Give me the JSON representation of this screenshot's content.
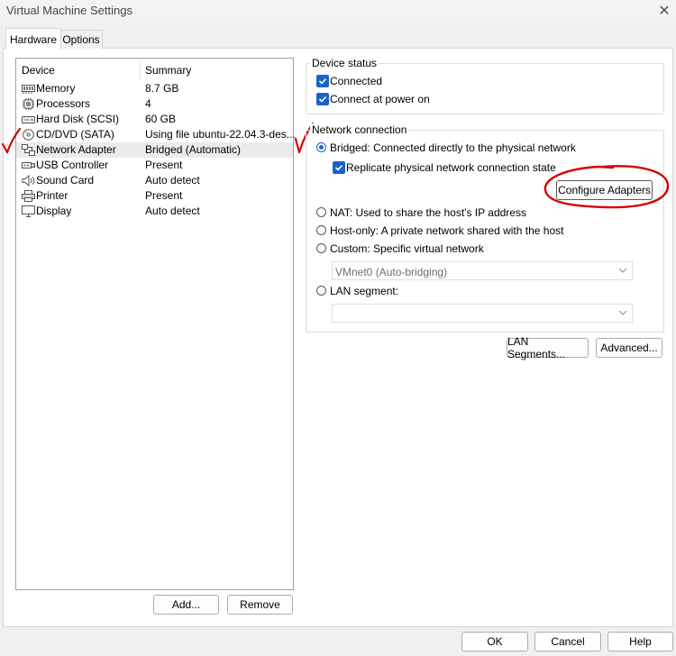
{
  "window": {
    "title": "Virtual Machine Settings",
    "close_glyph": "✕"
  },
  "tabs": [
    {
      "label": "Hardware",
      "active": true
    },
    {
      "label": "Options",
      "active": false
    }
  ],
  "device_list": {
    "col_device": "Device",
    "col_summary": "Summary",
    "rows": [
      {
        "device": "Memory",
        "summary": "8.7 GB",
        "icon": "memory-icon"
      },
      {
        "device": "Processors",
        "summary": "4",
        "icon": "processor-icon"
      },
      {
        "device": "Hard Disk (SCSI)",
        "summary": "60 GB",
        "icon": "hard-disk-icon"
      },
      {
        "device": "CD/DVD (SATA)",
        "summary": "Using file ubuntu-22.04.3-des...",
        "icon": "cd-dvd-icon"
      },
      {
        "device": "Network Adapter",
        "summary": "Bridged (Automatic)",
        "icon": "network-adapter-icon",
        "selected": true
      },
      {
        "device": "USB Controller",
        "summary": "Present",
        "icon": "usb-icon"
      },
      {
        "device": "Sound Card",
        "summary": "Auto detect",
        "icon": "speaker-icon"
      },
      {
        "device": "Printer",
        "summary": "Present",
        "icon": "printer-icon"
      },
      {
        "device": "Display",
        "summary": "Auto detect",
        "icon": "display-icon"
      }
    ]
  },
  "list_buttons": {
    "add": "Add...",
    "remove": "Remove"
  },
  "device_status": {
    "label": "Device status",
    "connected": "Connected",
    "connect_at_power_on": "Connect at power on"
  },
  "network_connection": {
    "label": "Network connection",
    "bridged": "Bridged: Connected directly to the physical network",
    "replicate": "Replicate physical network connection state",
    "configure_adapters": "Configure Adapters",
    "nat": "NAT: Used to share the host's IP address",
    "host_only": "Host-only: A private network shared with the host",
    "custom": "Custom: Specific virtual network",
    "custom_network_value": "VMnet0 (Auto-bridging)",
    "lan_segment": "LAN segment:",
    "lan_segment_value": ""
  },
  "network_buttons": {
    "lan_segments": "LAN Segments...",
    "advanced": "Advanced..."
  },
  "footer_buttons": {
    "ok": "OK",
    "cancel": "Cancel",
    "help": "Help"
  },
  "annotation_colors": {
    "red": "#d40000",
    "accent": "#1a64c8"
  }
}
